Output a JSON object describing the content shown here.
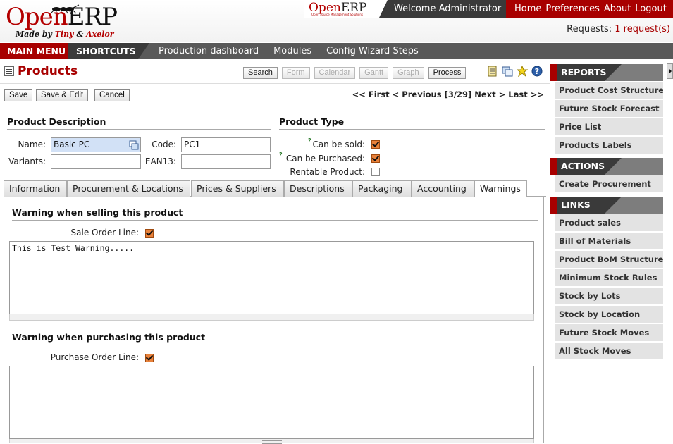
{
  "header": {
    "logo_open": "Open",
    "logo_erp": "ERP",
    "logo_sub_made_by": "Made by",
    "logo_sub_tiny": "Tiny",
    "logo_sub_amp": "&",
    "logo_sub_axelor": "Axelor",
    "mini_logo_open": "Open",
    "mini_logo_erp": "ERP",
    "mini_logo_tagline": "Open Source Management Solutions",
    "welcome": "Welcome Administrator",
    "links": [
      "Home",
      "Preferences",
      "About",
      "Logout"
    ],
    "requests_label": "Requests:",
    "requests_value": "1 request(s)"
  },
  "menubar": {
    "main_menu": "MAIN MENU",
    "shortcuts": "SHORTCUTS",
    "tabs": [
      "Production dashboard",
      "Modules",
      "Config Wizard Steps"
    ]
  },
  "page": {
    "title": "Products",
    "view_buttons": [
      "Search",
      "Form",
      "Calendar",
      "Gantt",
      "Graph",
      "Process"
    ],
    "view_disabled": [
      false,
      true,
      true,
      true,
      true,
      false
    ],
    "toolbar_icons": [
      "list-view-icon",
      "new-window-icon",
      "bug-report-icon",
      "help-icon"
    ]
  },
  "actions": {
    "save": "Save",
    "save_edit": "Save & Edit",
    "cancel": "Cancel",
    "pager": "<< First < Previous [3/29] Next > Last >>"
  },
  "form": {
    "product_description": "Product Description",
    "name_label": "Name:",
    "name_value": "Basic PC",
    "code_label": "Code:",
    "code_value": "PC1",
    "variants_label": "Variants:",
    "variants_value": "",
    "ean13_label": "EAN13:",
    "ean13_value": "",
    "product_type": "Product Type",
    "can_be_sold_label": "Can be sold:",
    "can_be_sold": true,
    "can_be_purchased_label": "Can be Purchased:",
    "can_be_purchased": true,
    "rentable_label": "Rentable Product:",
    "rentable": false,
    "help_mark": "?"
  },
  "tabs": [
    "Information",
    "Procurement & Locations",
    "Prices & Suppliers",
    "Descriptions",
    "Packaging",
    "Accounting",
    "Warnings"
  ],
  "active_tab": "Warnings",
  "warnings": {
    "selling_title": "Warning when selling this product",
    "sale_order_line_label": "Sale Order Line:",
    "sale_order_line": true,
    "selling_text": "This is Test Warning.....",
    "purchasing_title": "Warning when purchasing this product",
    "purchase_order_line_label": "Purchase Order Line:",
    "purchase_order_line": true,
    "purchasing_text": ""
  },
  "sidebar": {
    "reports_title": "REPORTS",
    "reports": [
      "Product Cost Structure",
      "Future Stock Forecast",
      "Price List",
      "Products Labels"
    ],
    "actions_title": "ACTIONS",
    "actions": [
      "Create Procurement"
    ],
    "links_title": "LINKS",
    "links": [
      "Product sales",
      "Bill of Materials",
      "Product BoM Structure",
      "Minimum Stock Rules",
      "Stock by Lots",
      "Stock by Location",
      "Future Stock Moves",
      "All Stock Moves"
    ]
  },
  "colors": {
    "brand_red": "#a80000",
    "dark_bar": "#3a3a3a",
    "menu_gray": "#595959",
    "checkbox_orange": "#e8813a",
    "required_field": "#d2e1f6"
  }
}
